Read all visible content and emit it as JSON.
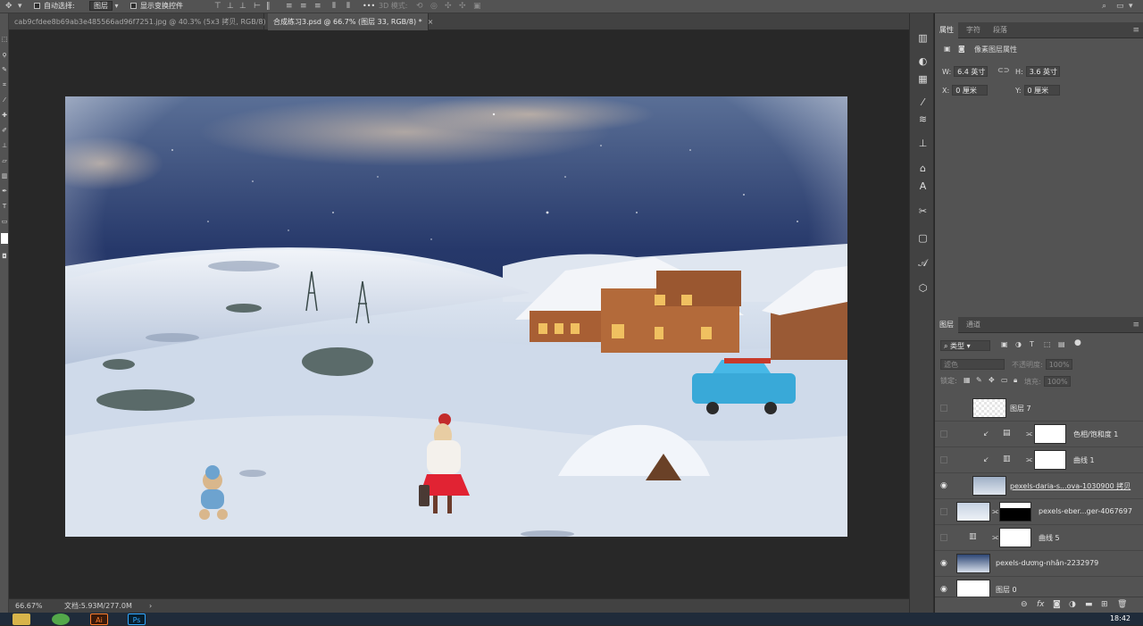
{
  "options_bar": {
    "auto_select_label": "自动选择:",
    "auto_select_value": "图层",
    "show_transform_label": "显示变换控件",
    "mode_3d_label": "3D 模式:",
    "more": "•••"
  },
  "tabs": [
    {
      "label": "cab9cfdee8b69ab3e485566ad96f7251.jpg @ 40.3% (5x3 拷贝, RGB/8) *",
      "close": "×",
      "active": false
    },
    {
      "label": "合成练习3.psd @ 66.7% (图层 33, RGB/8) *",
      "close": "×",
      "active": true
    }
  ],
  "statusbar": {
    "zoom": "66.67%",
    "doc_info": "文档:5.93M/277.0M",
    "arrow": "›"
  },
  "properties": {
    "tabs": [
      "属性",
      "字符",
      "段落"
    ],
    "title": "像素图层属性",
    "w_label": "W:",
    "w_value": "6.4 英寸",
    "h_label": "H:",
    "h_value": "3.6 英寸",
    "x_label": "X:",
    "x_value": "0 厘米",
    "y_label": "Y:",
    "y_value": "0 厘米",
    "link_icon": "link-icon"
  },
  "layers": {
    "tabs": [
      "图层",
      "通道"
    ],
    "filter_label": "类型",
    "blend_mode": "滤色",
    "opacity_label": "不透明度:",
    "opacity_value": "100%",
    "lock_label": "锁定:",
    "fill_label": "填充:",
    "fill_value": "100%",
    "items": [
      {
        "name": "图层 7",
        "visible": false,
        "thumb": "transparent"
      },
      {
        "name": "色相/饱和度 1",
        "visible": false,
        "thumb": "adjustment",
        "clipped": true
      },
      {
        "name": "曲线 1",
        "visible": false,
        "thumb": "adjustment",
        "clipped": true
      },
      {
        "name": "pexels-daria-s...ova-1030900 拷贝",
        "visible": true,
        "thumb": "image"
      },
      {
        "name": "pexels-eber...ger-4067697",
        "visible": false,
        "thumb": "image-mask"
      },
      {
        "name": "曲线 5",
        "visible": false,
        "thumb": "adjustment"
      },
      {
        "name": "pexels-dương-nhân-2232979",
        "visible": true,
        "thumb": "smart"
      },
      {
        "name": "图层 0",
        "visible": true,
        "thumb": "white"
      }
    ],
    "bottom_icons": [
      "link-layers-icon",
      "fx-icon",
      "add-mask-icon",
      "adjustment-layer-icon",
      "new-group-icon",
      "new-layer-icon",
      "delete-layer-icon"
    ]
  },
  "taskbar": {
    "time": "18:42",
    "ai_label": "Ai",
    "ps_label": "Ps"
  }
}
